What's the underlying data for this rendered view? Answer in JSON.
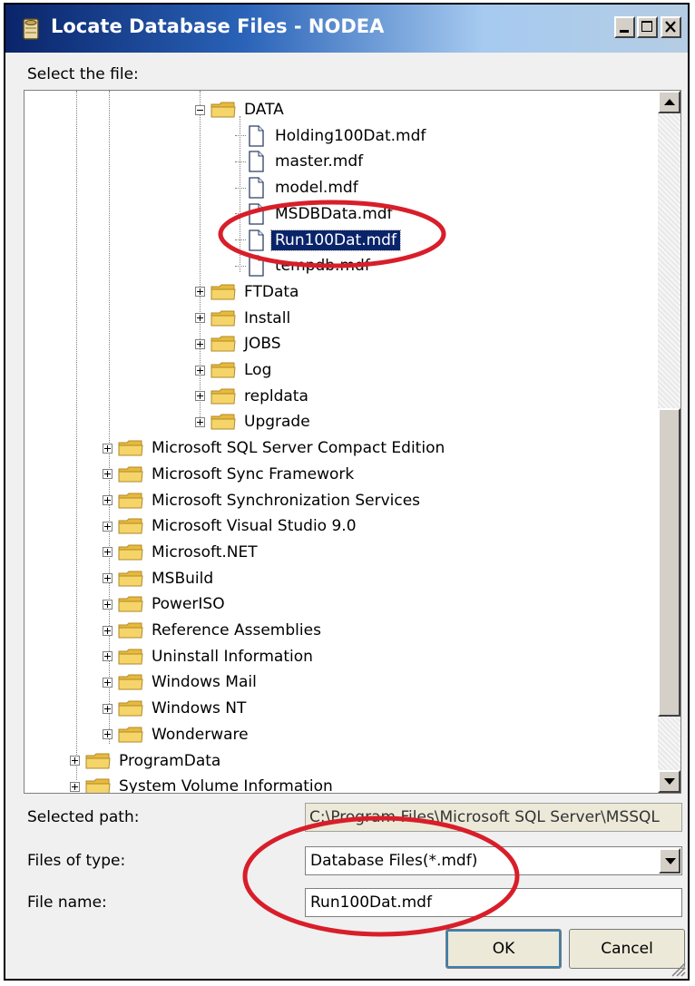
{
  "window": {
    "title": "Locate Database Files - NODEA",
    "minimize_glyph": "_",
    "maximize_glyph": "□",
    "close_glyph": "✕"
  },
  "tree": {
    "label": "Select the file:",
    "rows": [
      {
        "name": "tree-folder-data",
        "text": "DATA",
        "type": "folder",
        "expander": "minus"
      },
      {
        "name": "tree-file-holding100dat",
        "text": "Holding100Dat.mdf",
        "type": "file"
      },
      {
        "name": "tree-file-master",
        "text": "master.mdf",
        "type": "file"
      },
      {
        "name": "tree-file-model",
        "text": "model.mdf",
        "type": "file"
      },
      {
        "name": "tree-file-msdbdata",
        "text": "MSDBData.mdf",
        "type": "file"
      },
      {
        "name": "tree-file-run100dat",
        "text": "Run100Dat.mdf",
        "type": "file",
        "selected": true
      },
      {
        "name": "tree-file-tempdb",
        "text": "tempdb.mdf",
        "type": "file"
      },
      {
        "name": "tree-folder-ftdata",
        "text": "FTData",
        "type": "folder",
        "expander": "plus"
      },
      {
        "name": "tree-folder-install",
        "text": "Install",
        "type": "folder",
        "expander": "plus"
      },
      {
        "name": "tree-folder-jobs",
        "text": "JOBS",
        "type": "folder",
        "expander": "plus"
      },
      {
        "name": "tree-folder-log",
        "text": "Log",
        "type": "folder",
        "expander": "plus"
      },
      {
        "name": "tree-folder-repldata",
        "text": "repldata",
        "type": "folder",
        "expander": "plus"
      },
      {
        "name": "tree-folder-upgrade",
        "text": "Upgrade",
        "type": "folder",
        "expander": "plus"
      },
      {
        "name": "tree-folder-sql-compact",
        "text": "Microsoft SQL Server Compact Edition",
        "type": "folder",
        "expander": "plus"
      },
      {
        "name": "tree-folder-sync-framework",
        "text": "Microsoft Sync Framework",
        "type": "folder",
        "expander": "plus"
      },
      {
        "name": "tree-folder-sync-services",
        "text": "Microsoft Synchronization Services",
        "type": "folder",
        "expander": "plus"
      },
      {
        "name": "tree-folder-visual-studio",
        "text": "Microsoft Visual Studio 9.0",
        "type": "folder",
        "expander": "plus"
      },
      {
        "name": "tree-folder-dotnet",
        "text": "Microsoft.NET",
        "type": "folder",
        "expander": "plus"
      },
      {
        "name": "tree-folder-msbuild",
        "text": "MSBuild",
        "type": "folder",
        "expander": "plus"
      },
      {
        "name": "tree-folder-poweriso",
        "text": "PowerISO",
        "type": "folder",
        "expander": "plus"
      },
      {
        "name": "tree-folder-reference-assemblies",
        "text": "Reference Assemblies",
        "type": "folder",
        "expander": "plus"
      },
      {
        "name": "tree-folder-uninstall-information",
        "text": "Uninstall Information",
        "type": "folder",
        "expander": "plus"
      },
      {
        "name": "tree-folder-windows-mail",
        "text": "Windows Mail",
        "type": "folder",
        "expander": "plus"
      },
      {
        "name": "tree-folder-windows-nt",
        "text": "Windows NT",
        "type": "folder",
        "expander": "plus"
      },
      {
        "name": "tree-folder-wonderware",
        "text": "Wonderware",
        "type": "folder",
        "expander": "plus"
      },
      {
        "name": "tree-folder-programdata",
        "text": "ProgramData",
        "type": "folder",
        "expander": "plus"
      },
      {
        "name": "tree-folder-system-volume-information",
        "text": "System Volume Information",
        "type": "folder",
        "expander": "plus"
      }
    ]
  },
  "selected_path": {
    "label": "Selected path:",
    "value": "C:\\Program Files\\Microsoft SQL Server\\MSSQL"
  },
  "files_of_type": {
    "label": "Files of type:",
    "value": "Database Files(*.mdf)"
  },
  "file_name": {
    "label": "File name:",
    "value": "Run100Dat.mdf"
  },
  "buttons": {
    "ok": "OK",
    "cancel": "Cancel"
  },
  "colors": {
    "title_gradient_start": "#0a246a",
    "selection": "#0a246a",
    "annotation_red": "#d81e2a",
    "folder_yellow": "#f5d46a"
  }
}
